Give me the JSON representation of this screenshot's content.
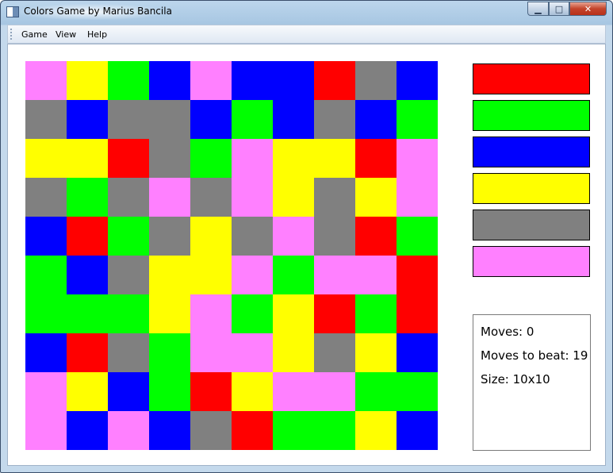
{
  "window": {
    "title": "Colors Game by Marius Bancila"
  },
  "window_controls": {
    "minimize": "▁",
    "maximize": "□",
    "close": "✕"
  },
  "menu": {
    "items": [
      "Game",
      "View",
      "Help"
    ]
  },
  "palette": [
    {
      "name": "red",
      "color": "#ff0000"
    },
    {
      "name": "green",
      "color": "#00ff00"
    },
    {
      "name": "blue",
      "color": "#0000ff"
    },
    {
      "name": "yellow",
      "color": "#ffff00"
    },
    {
      "name": "gray",
      "color": "#808080"
    },
    {
      "name": "pink",
      "color": "#ff80ff"
    }
  ],
  "board": {
    "rows": 10,
    "cols": 10,
    "cells": [
      [
        "P",
        "Y",
        "G",
        "B",
        "P",
        "B",
        "B",
        "R",
        "Gr",
        "B"
      ],
      [
        "Gr",
        "B",
        "Gr",
        "Gr",
        "B",
        "G",
        "B",
        "Gr",
        "B",
        "G"
      ],
      [
        "Y",
        "Y",
        "R",
        "Gr",
        "G",
        "P",
        "Y",
        "Y",
        "R",
        "P"
      ],
      [
        "Gr",
        "G",
        "Gr",
        "P",
        "Gr",
        "P",
        "Y",
        "Gr",
        "Y",
        "P"
      ],
      [
        "B",
        "R",
        "G",
        "Gr",
        "Y",
        "Gr",
        "P",
        "Gr",
        "R",
        "G"
      ],
      [
        "G",
        "B",
        "Gr",
        "Y",
        "Y",
        "P",
        "G",
        "P",
        "P",
        "R"
      ],
      [
        "G",
        "G",
        "G",
        "Y",
        "P",
        "G",
        "Y",
        "R",
        "G",
        "R"
      ],
      [
        "B",
        "R",
        "Gr",
        "G",
        "P",
        "P",
        "Y",
        "Gr",
        "Y",
        "B"
      ],
      [
        "P",
        "Y",
        "B",
        "G",
        "R",
        "Y",
        "P",
        "P",
        "G",
        "G"
      ],
      [
        "P",
        "B",
        "P",
        "B",
        "Gr",
        "R",
        "G",
        "G",
        "Y",
        "B"
      ]
    ],
    "legend": {
      "R": "#ff0000",
      "G": "#00ff00",
      "B": "#0000ff",
      "Y": "#ffff00",
      "Gr": "#808080",
      "P": "#ff80ff"
    }
  },
  "info": {
    "moves": "Moves: 0",
    "moves_to_beat": "Moves to beat: 19",
    "size": "Size: 10x10"
  }
}
